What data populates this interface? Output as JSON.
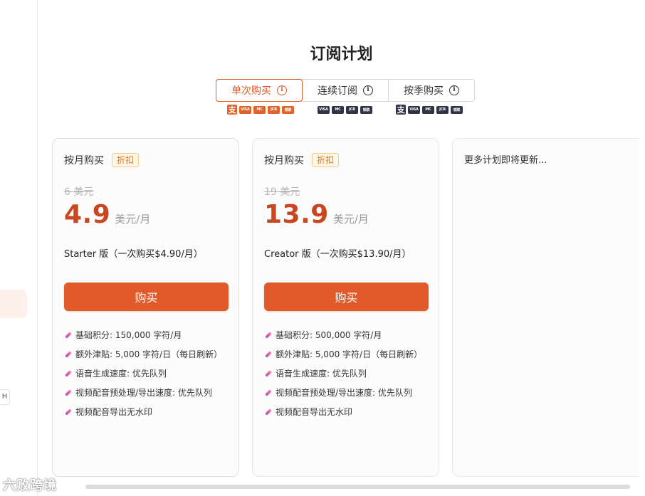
{
  "page": {
    "title": "订阅计划"
  },
  "tabs": [
    {
      "label": "单次购买",
      "active": true
    },
    {
      "label": "连续订阅",
      "active": false
    },
    {
      "label": "按季购买",
      "active": false
    }
  ],
  "payment_icons": {
    "alipay": "支",
    "visa": "VISA",
    "mastercard": "MC",
    "jcb": "JCB",
    "unionpay": "银联"
  },
  "plans": [
    {
      "type_label": "按月购买",
      "badge": "折扣",
      "old_price": "6 美元",
      "price": "4.9",
      "unit": "美元/月",
      "description": "Starter 版（一次购买$4.90/月）",
      "buy_label": "购买",
      "features": [
        "基础积分: 150,000 字符/月",
        "额外津贴: 5,000 字符/日（每日刷新）",
        "语音生成速度: 优先队列",
        "视频配音预处理/导出速度: 优先队列",
        "视频配音导出无水印"
      ]
    },
    {
      "type_label": "按月购买",
      "badge": "折扣",
      "old_price": "19 美元",
      "price": "13.9",
      "unit": "美元/月",
      "description": "Creator 版（一次购买$13.90/月）",
      "buy_label": "购买",
      "features": [
        "基础积分: 500,000 字符/月",
        "额外津贴: 5,000 字符/日（每日刷新）",
        "语音生成速度: 优先队列",
        "视频配音预处理/导出速度: 优先队列",
        "视频配音导出无水印"
      ]
    }
  ],
  "more_plans_text": "更多计划即将更新...",
  "sidebar": {
    "chip_text": "H"
  },
  "watermark": "六败跨境",
  "colors": {
    "accent": "#e05a2a",
    "price": "#c9471e",
    "badge": "#d9772b"
  }
}
